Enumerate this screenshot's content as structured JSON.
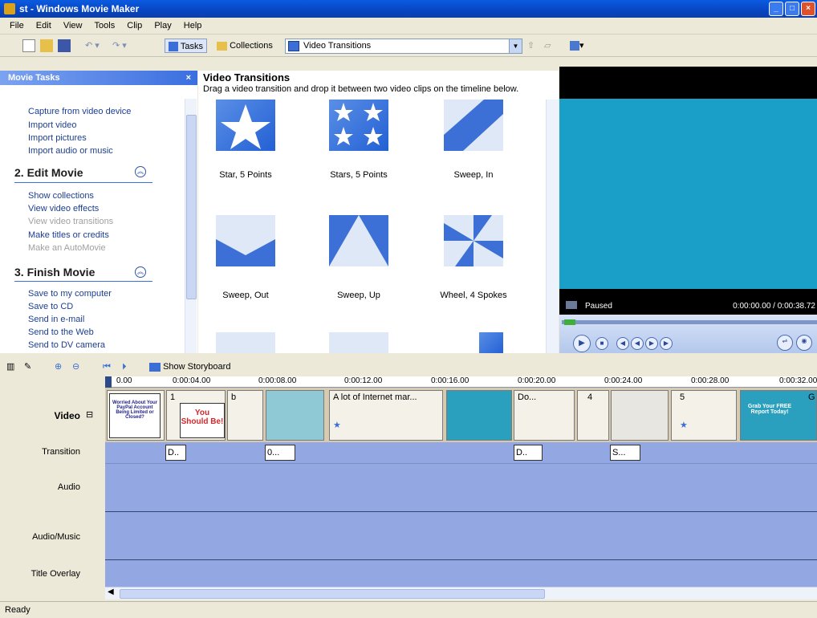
{
  "window": {
    "title": "st - Windows Movie Maker"
  },
  "menu": [
    "File",
    "Edit",
    "View",
    "Tools",
    "Clip",
    "Play",
    "Help"
  ],
  "toolbar": {
    "tasks_label": "Tasks",
    "collections_label": "Collections",
    "collection_selected": "Video Transitions"
  },
  "taskpane": {
    "title": "Movie Tasks",
    "close": "×",
    "capture_links": [
      "Capture from video device",
      "Import video",
      "Import pictures",
      "Import audio or music"
    ],
    "edit": {
      "title": "2. Edit Movie",
      "links": [
        "Show collections",
        "View video effects",
        "View video transitions",
        "Make titles or credits",
        "Make an AutoMovie"
      ]
    },
    "finish": {
      "title": "3. Finish Movie",
      "links": [
        "Save to my computer",
        "Save to CD",
        "Send in e-mail",
        "Send to the Web",
        "Send to DV camera"
      ]
    }
  },
  "transitions": {
    "title": "Video Transitions",
    "subtitle": "Drag a video transition and drop it between two video clips on the timeline below.",
    "items": [
      "Star, 5 Points",
      "Stars, 5 Points",
      "Sweep, In",
      "Sweep, Out",
      "Sweep, Up",
      "Wheel, 4 Spokes"
    ]
  },
  "monitor": {
    "status": "Paused",
    "timecode": "0:00:00.00 / 0:00:38.72"
  },
  "timeline": {
    "show_storyboard": "Show Storyboard",
    "ruler": [
      "0.00",
      "0:00:04.00",
      "0:00:08.00",
      "0:00:12.00",
      "0:00:16.00",
      "0:00:20.00",
      "0:00:24.00",
      "0:00:28.00",
      "0:00:32.00"
    ],
    "tracks": [
      "Video",
      "Transition",
      "Audio",
      "Audio/Music",
      "Title Overlay"
    ],
    "clips": [
      "1",
      "b",
      "A lot of Internet mar...",
      "Do...",
      "4",
      "5",
      "G"
    ],
    "transition_boxes": [
      "D..",
      "0...",
      "D..",
      "S..."
    ],
    "clip_text": {
      "c1": "Worried About Your PayPal Account Being Limited or Closed?",
      "c2": "You Should Be!",
      "c3": "Grab Your FREE Report Today!"
    }
  },
  "status": "Ready"
}
